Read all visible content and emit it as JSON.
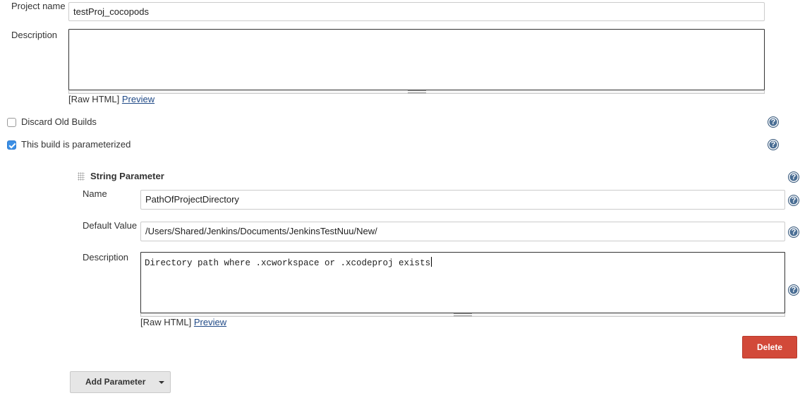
{
  "project": {
    "name_label": "Project name",
    "name_value": "testProj_cocopods",
    "description_label": "Description",
    "description_value": "",
    "raw_html_label": "[Raw HTML]",
    "preview_link": "Preview"
  },
  "options": {
    "discard_old_builds": {
      "label": "Discard Old Builds",
      "checked": false
    },
    "parameterized": {
      "label": "This build is parameterized",
      "checked": true
    }
  },
  "parameter": {
    "title": "String Parameter",
    "name_label": "Name",
    "name_value": "PathOfProjectDirectory",
    "default_label": "Default Value",
    "default_value": "/Users/Shared/Jenkins/Documents/JenkinsTestNuu/New/",
    "description_label": "Description",
    "description_value": "Directory path where .xcworkspace or .xcodeproj exists",
    "raw_html_label": "[Raw HTML]",
    "preview_link": "Preview",
    "delete_label": "Delete"
  },
  "add_parameter": {
    "label": "Add Parameter"
  },
  "icons": {
    "help": "question-mark-circle",
    "drag": "drag-handle-dots",
    "dropdown": "chevron-down"
  },
  "colors": {
    "delete_button": "#d24939",
    "checkbox_checked": "#3b8fe5",
    "help_icon": "#4a6e94",
    "link": "#204a87"
  }
}
